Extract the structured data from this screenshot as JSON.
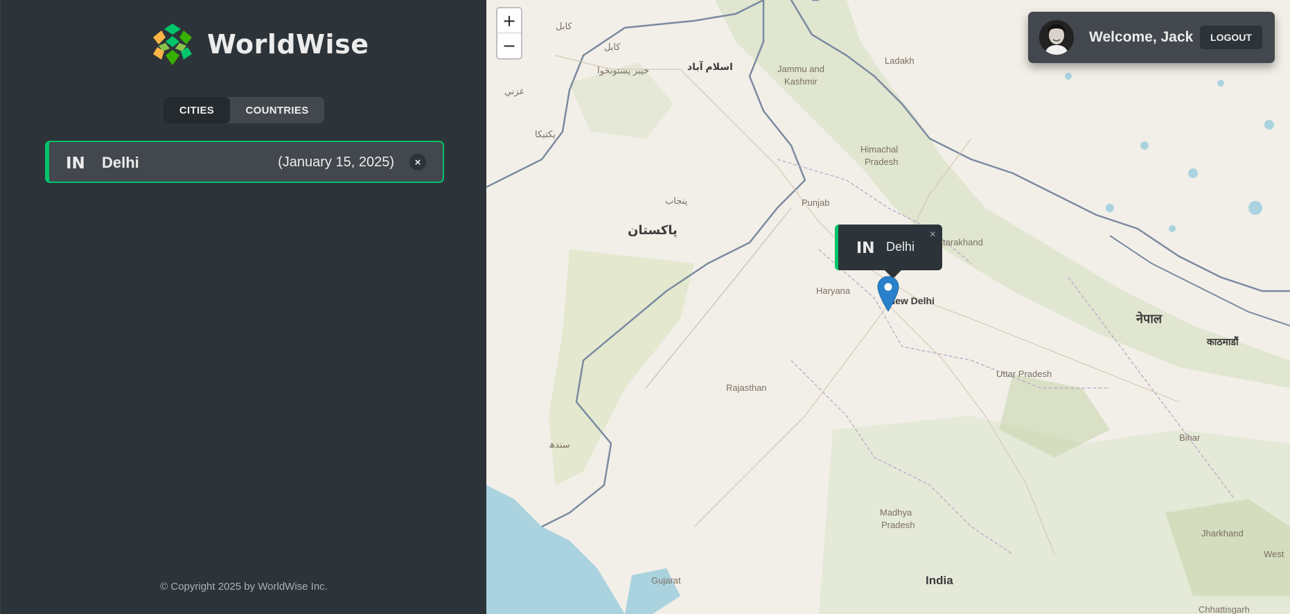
{
  "app": {
    "name": "WorldWise"
  },
  "nav": {
    "tabs": [
      {
        "label": "CITIES",
        "active": true
      },
      {
        "label": "COUNTRIES",
        "active": false
      }
    ]
  },
  "cities": [
    {
      "flag": "IN",
      "name": "Delhi",
      "date": "(January 15, 2025)",
      "delete_icon": "×"
    }
  ],
  "footer": {
    "copyright": "© Copyright 2025 by WorldWise Inc."
  },
  "map": {
    "zoom_in": "+",
    "zoom_out": "−",
    "labels": {
      "kabul": "کابل",
      "islamabad": "اسلام آباد",
      "jammu_kashmir_1": "Jammu and",
      "jammu_kashmir_2": "Kashmir",
      "ladakh": "Ladakh",
      "himachal_1": "Himachal",
      "himachal_2": "Pradesh",
      "punjab": "Punjab",
      "pakistan": "پاکستان",
      "uttarakhand": "Uttarakhand",
      "haryana": "Haryana",
      "new_delhi": "New Delhi",
      "nepal": "नेपाल",
      "kathmandu": "काठमाडौं",
      "uttar_pradesh": "Uttar Pradesh",
      "rajasthan": "Rajasthan",
      "madhya_1": "Madhya",
      "madhya_2": "Pradesh",
      "bihar": "Bihar",
      "jharkhand": "Jharkhand",
      "west": "West",
      "gujarat": "Gujarat",
      "india": "India",
      "chhattisgarh": "Chhattisgarh",
      "sindh": "سندھ",
      "punjab_pk": "پنجاب",
      "pakhtunkhwa": "خیبر پښتونخوا",
      "kabul2": "کابل",
      "ghazni": "غزني",
      "paktika": "پکتیکا"
    }
  },
  "user": {
    "welcome": "Welcome, Jack",
    "logout": "LOGOUT"
  },
  "popup": {
    "flag": "IN",
    "name": "Delhi",
    "close": "×"
  },
  "colors": {
    "accent": "#00c46a",
    "sidebar": "#2d3439",
    "panel": "#42484d",
    "text": "#ececec",
    "marker": "#2a81cb"
  }
}
